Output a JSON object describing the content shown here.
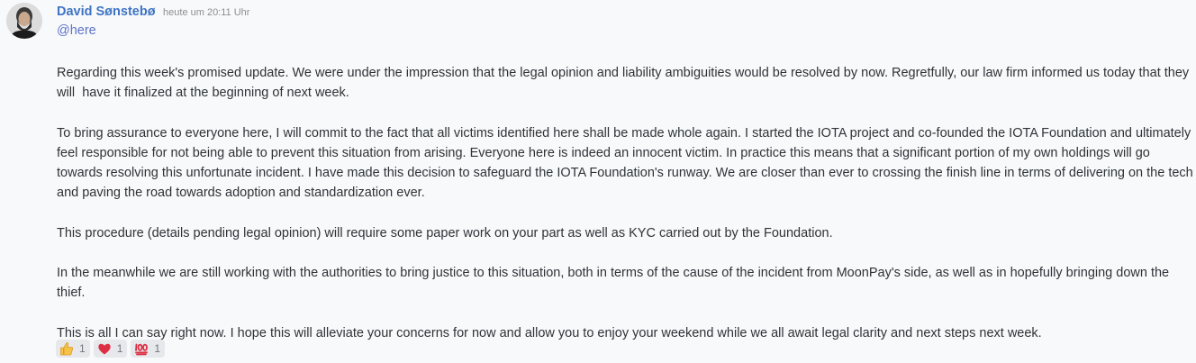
{
  "message": {
    "author": "David Sønstebø",
    "timestamp": "heute um 20:11 Uhr",
    "mention": "@here",
    "paragraphs": [
      "Regarding this week's promised update. We were under the impression that the legal opinion and liability ambiguities would be resolved by now. Regretfully, our law firm informed us today that they will  have it finalized at the beginning of next week.",
      "To bring assurance to everyone here, I will commit to the fact that all victims identified here shall be made whole again. I started the IOTA project and co-founded the IOTA Foundation and ultimately feel responsible for not being able to prevent this situation from arising. Everyone here is indeed an innocent victim. In practice this means that a significant portion of my own holdings will go towards resolving this unfortunate incident. I have made this decision to safeguard the IOTA Foundation's runway. We are closer than ever to crossing the finish line in terms of delivering on the tech and paving the road towards adoption and standardization ever.",
      "This procedure (details pending legal opinion) will require some paper work on your part as well as KYC carried out by the Foundation.",
      "In the meanwhile we are still working with the authorities to bring justice to this situation, both in terms of the cause of the incident from MoonPay's side, as well as in hopefully bringing down the thief.",
      "This is all I can say right now. I hope this will alleviate your concerns for now and allow you to enjoy your weekend while we all await legal clarity and next steps next week."
    ]
  },
  "reactions": [
    {
      "emoji": "thumbs-up-icon",
      "count": "1"
    },
    {
      "emoji": "red-heart-icon",
      "count": "1"
    },
    {
      "emoji": "hundred-points-icon",
      "count": "1"
    }
  ],
  "colors": {
    "author": "#3f74c4",
    "mention": "#5f73c8",
    "text": "#2e3338",
    "timestamp": "#8a8e94",
    "background": "#f8f9fa",
    "reaction_bg": "#e6e8ec"
  }
}
